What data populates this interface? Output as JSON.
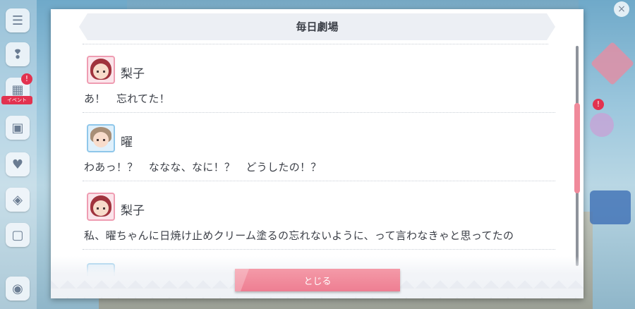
{
  "dialog": {
    "title": "毎日劇場",
    "entries": [
      {
        "speaker": "梨子",
        "line": "あ！　忘れてた！",
        "avatar": "pink"
      },
      {
        "speaker": "曜",
        "line": "わあっ！？　ななな、なに！？　どうしたの！？",
        "avatar": "blue"
      },
      {
        "speaker": "梨子",
        "line": "私、曜ちゃんに日焼け止めクリーム塗るの忘れないように、って言わなきゃと思ってたの",
        "avatar": "pink"
      }
    ],
    "close_label": "とじる"
  },
  "side_menu": {
    "badge_count": "!",
    "event_tag": "イベント"
  },
  "right_menu": {
    "badge": "!"
  },
  "colors": {
    "accent_pink": "#ee7e92",
    "scroll_thumb": "#f08a9b",
    "text": "#3b3f47"
  }
}
